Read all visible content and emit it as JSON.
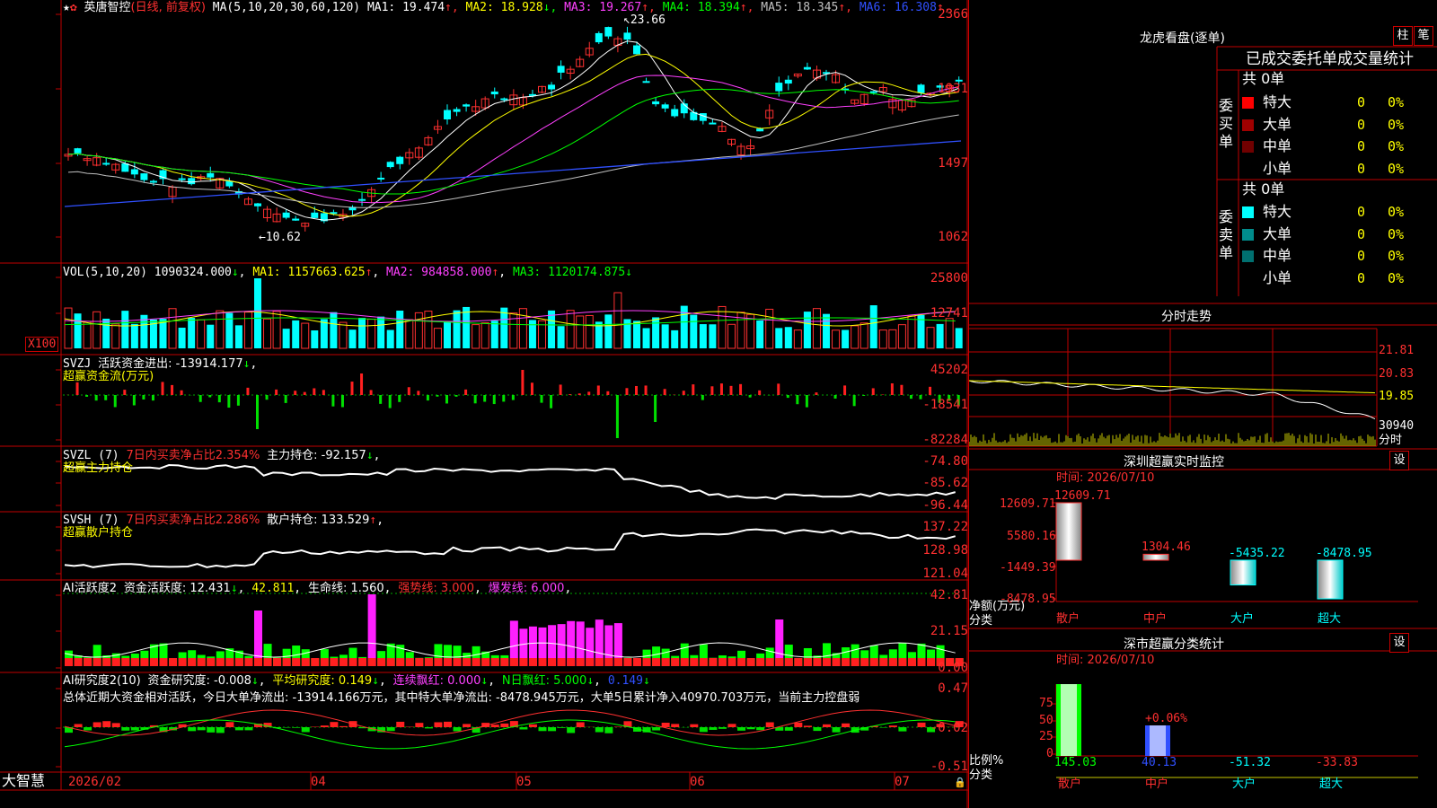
{
  "stock": {
    "name": "英唐智控",
    "mode": "(日线, 前复权)",
    "ma_label": "MA(5,10,20,30,60,120)",
    "ma": [
      {
        "label": "MA1:",
        "value": "19.474",
        "arrow": "↑",
        "color": "#ffffff"
      },
      {
        "label": "MA2:",
        "value": "18.928",
        "arrow": "↓",
        "color": "#ffff00"
      },
      {
        "label": "MA3:",
        "value": "19.267",
        "arrow": "↑",
        "color": "#ff40ff"
      },
      {
        "label": "MA4:",
        "value": "18.394",
        "arrow": "↑",
        "color": "#00ff00"
      },
      {
        "label": "MA5:",
        "value": "18.345",
        "arrow": "↑",
        "color": "#c0c0c0"
      },
      {
        "label": "MA6:",
        "value": "16.308",
        "arrow": "↑",
        "color": "#3050ff"
      }
    ],
    "high_mark": "23.66",
    "low_mark": "10.62"
  },
  "price_axis": [
    "2366",
    "1931",
    "1497",
    "1062"
  ],
  "vol": {
    "label": "VOL(5,10,20)",
    "value": "1090324.000",
    "ma1": "MA1: 1157663.625",
    "ma2": "MA2: 984858.000",
    "ma3": "MA3: 1120174.875",
    "axis": [
      "25800",
      "12741"
    ],
    "unit": "X100"
  },
  "svzj": {
    "label": "SVZJ",
    "desc": "活跃资金进出: -13914.177",
    "sub": "超赢资金流(万元)",
    "axis": [
      "45202",
      "-18541",
      "-82284"
    ]
  },
  "svzl": {
    "label": "SVZL (7)",
    "pct": "7日内买卖净占比2.354%",
    "hold": "主力持仓: -92.157",
    "sub": "超赢主力持仓",
    "axis": [
      "-74.80",
      "-85.62",
      "-96.44"
    ]
  },
  "svsh": {
    "label": "SVSH (7)",
    "pct": "7日内买卖净占比2.286%",
    "hold": "散户持仓: 133.529",
    "sub": "超赢散户持仓",
    "axis": [
      "137.22",
      "128.98",
      "121.04"
    ]
  },
  "ai_act": {
    "label": "AI活跃度2",
    "a": "资金活跃度: 12.431",
    "b": "42.811",
    "c": "生命线: 1.560",
    "d": "强势线: 3.000",
    "e": "爆发线: 6.000",
    "axis": [
      "42.81",
      "21.15",
      "0.00"
    ]
  },
  "ai_res": {
    "label": "AI研究度2(10)",
    "a": "资金研究度: -0.008",
    "b": "平均研究度: 0.149",
    "c": "连续飘红: 0.000",
    "d": "N日飘红: 5.000",
    "e": "0.149",
    "summary": "总体近期大资金相对活跃，今日大单净流出: -13914.166万元，其中特大单净流出: -8478.945万元，大单5日累计净入40970.703万元，当前主力控盘弱",
    "axis": [
      "0.47",
      "-0.02",
      "-0.51"
    ]
  },
  "date_axis": [
    "2026/02",
    "04",
    "05",
    "06",
    "07"
  ],
  "brand": "大智慧",
  "dragon": {
    "title": "龙虎看盘(逐单)",
    "btn1": "柱",
    "btn2": "笔",
    "tabs": "已成交委托单成交量统计",
    "buy_group": "委买单",
    "sell_group": "委卖单",
    "buy_count": "共 0单",
    "sell_count": "共 0单",
    "buy_rows": [
      {
        "name": "特大",
        "val": "0",
        "pct": "0%",
        "color": "#ff0000"
      },
      {
        "name": "大单",
        "val": "0",
        "pct": "0%",
        "color": "#a00000"
      },
      {
        "name": "中单",
        "val": "0",
        "pct": "0%",
        "color": "#700000"
      },
      {
        "name": "小单",
        "val": "0",
        "pct": "0%",
        "color": "#000000"
      }
    ],
    "sell_rows": [
      {
        "name": "特大",
        "val": "0",
        "pct": "0%",
        "color": "#00ffff"
      },
      {
        "name": "大单",
        "val": "0",
        "pct": "0%",
        "color": "#008c8c"
      },
      {
        "name": "中单",
        "val": "0",
        "pct": "0%",
        "color": "#007070"
      },
      {
        "name": "小单",
        "val": "0",
        "pct": "0%",
        "color": "#000000"
      }
    ]
  },
  "intraday": {
    "title": "分时走势",
    "axis": [
      "21.81",
      "20.83",
      "19.85"
    ],
    "vol": "30940",
    "vol_unit": "分时"
  },
  "sz_monitor": {
    "title": "深圳超赢实时监控",
    "btn": "设",
    "time": "时间: 2026/07/10",
    "axis": [
      "12609.71",
      "5580.16",
      "-1449.39",
      "-8478.95"
    ],
    "ylabel1": "净额(万元)",
    "ylabel2": "分类",
    "bars": [
      {
        "cat": "散户",
        "value": 12609.71,
        "label": "12609.71",
        "color": "#ff3030",
        "fill": "#ffffff"
      },
      {
        "cat": "中户",
        "value": 1304.46,
        "label": "1304.46",
        "color": "#ff3030",
        "fill": "#ffffff"
      },
      {
        "cat": "大户",
        "value": -5435.22,
        "label": "-5435.22",
        "color": "#00ffff",
        "fill": "#ffffff"
      },
      {
        "cat": "超大",
        "value": -8478.95,
        "label": "-8478.95",
        "color": "#00ffff",
        "fill": "#ffffff"
      }
    ],
    "ylim": [
      -8478.95,
      12609.71
    ]
  },
  "sh_stats": {
    "title": "深市超赢分类统计",
    "btn": "设",
    "time": "时间: 2026/07/10",
    "axis": [
      "75",
      "50",
      "25",
      "0"
    ],
    "ylabel1": "比例%",
    "ylabel2": "分类",
    "mid_label": "+0.06%",
    "cats": [
      {
        "cat": "散户",
        "value": "145.03",
        "color": "#00ff00"
      },
      {
        "cat": "中户",
        "value": "40.13",
        "color": "#3050ff"
      },
      {
        "cat": "大户",
        "value": "-51.32",
        "color": "#00ffff"
      },
      {
        "cat": "超大",
        "value": "-33.83",
        "color": "#ff3030"
      }
    ]
  },
  "colors": {
    "up": "#ff3030",
    "down": "#00ffff",
    "grid": "#c00000"
  }
}
